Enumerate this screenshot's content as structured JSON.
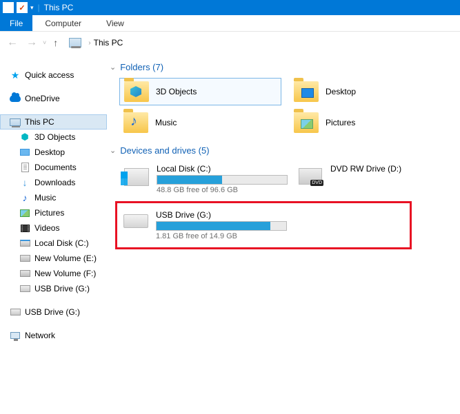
{
  "titlebar": {
    "title": "This PC"
  },
  "ribbon": {
    "file": "File",
    "tabs": [
      "Computer",
      "View"
    ]
  },
  "breadcrumb": {
    "location": "This PC"
  },
  "sidebar": {
    "quick_access": "Quick access",
    "onedrive": "OneDrive",
    "this_pc": "This PC",
    "pc_children": [
      "3D Objects",
      "Desktop",
      "Documents",
      "Downloads",
      "Music",
      "Pictures",
      "Videos",
      "Local Disk (C:)",
      "New Volume (E:)",
      "New Volume (F:)",
      "USB Drive (G:)"
    ],
    "usb_drive": "USB Drive (G:)",
    "network": "Network"
  },
  "groups": {
    "folders": {
      "title": "Folders (7)",
      "items": [
        "3D Objects",
        "Desktop",
        "Music",
        "Pictures"
      ]
    },
    "devices": {
      "title": "Devices and drives (5)",
      "local": {
        "name": "Local Disk (C:)",
        "free": "48.8 GB free of 96.6 GB",
        "fill_pct": 50
      },
      "dvd": {
        "name": "DVD RW Drive (D:)"
      },
      "usb": {
        "name": "USB Drive (G:)",
        "free": "1.81 GB free of 14.9 GB",
        "fill_pct": 88
      }
    }
  }
}
